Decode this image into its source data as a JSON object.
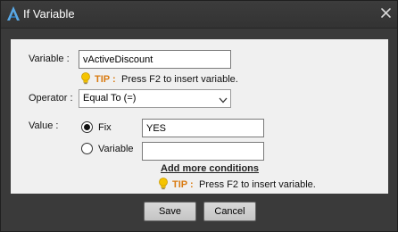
{
  "window": {
    "title": "If Variable",
    "icon": "app-logo-icon",
    "close_icon": "close-icon"
  },
  "form": {
    "variable_label": "Variable :",
    "variable_value": "vActiveDiscount",
    "tip1": {
      "key": "TIP :",
      "text": "Press F2 to insert variable."
    },
    "operator_label": "Operator :",
    "operator_selected": "Equal To (=)",
    "value_label": "Value :",
    "value_type": {
      "options": [
        {
          "label": "Fix",
          "selected": true
        },
        {
          "label": "Variable",
          "selected": false
        }
      ]
    },
    "fix_value": "YES",
    "variable_value_field": "",
    "add_more_label": "Add more conditions",
    "tip2": {
      "key": "TIP :",
      "text": "Press F2 to insert variable."
    }
  },
  "buttons": {
    "save": "Save",
    "cancel": "Cancel"
  },
  "colors": {
    "window_bg": "#3a3a3a",
    "panel_bg": "#f0f0f0",
    "tip_accent": "#d97a10",
    "bulb": "#f5c400"
  }
}
